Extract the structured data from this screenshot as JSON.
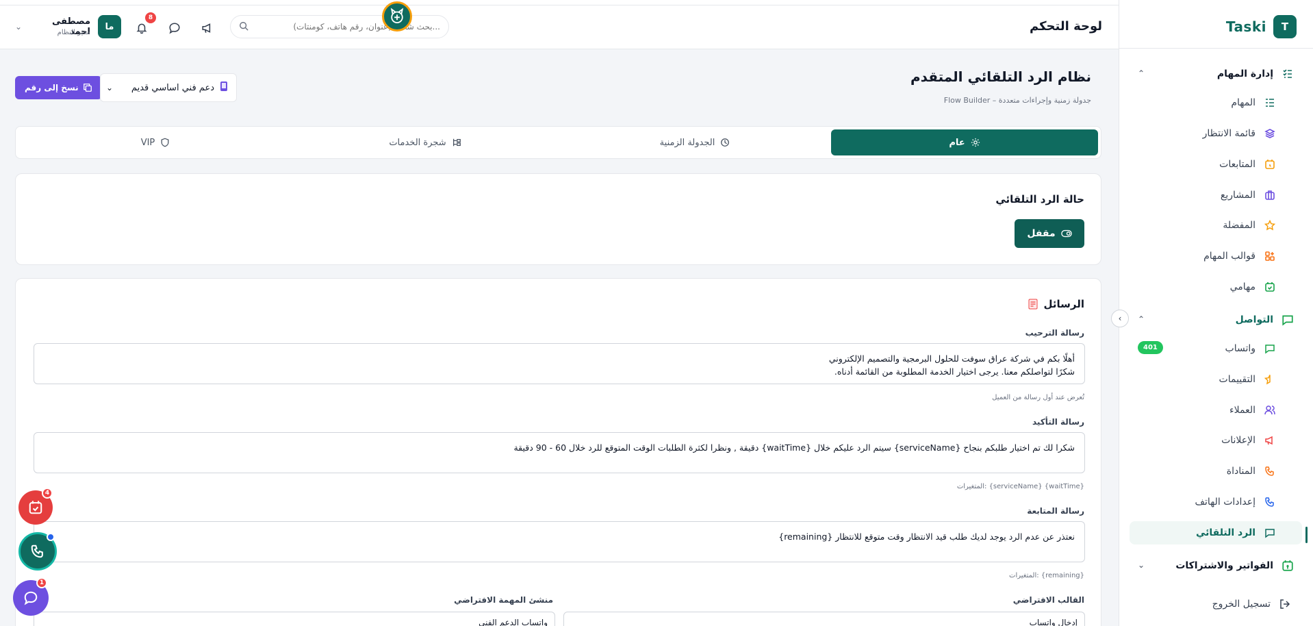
{
  "app": {
    "brand_letter": "T",
    "brand_name": "Taski"
  },
  "header": {
    "title": "لوحة التحكم",
    "search_placeholder": "بحث شامل (عنوان، رقم هاتف، كومنتات)...",
    "notification_count": "8",
    "user_initials": "ما",
    "user_name": "مصطفى احمد",
    "user_role": "مدير النظام"
  },
  "sidebar": {
    "task_group": "إدارة المهام",
    "task_items": [
      "المهام",
      "قائمة الانتظار",
      "المتابعات",
      "المشاريع",
      "المفضلة",
      "قوالب المهام",
      "مهامي"
    ],
    "comm_group": "التواصل",
    "comm_items": [
      "واتساب",
      "التقييمات",
      "العملاء",
      "الإعلانات",
      "المناداة",
      "إعدادات الهاتف",
      "الرد التلقائي"
    ],
    "whatsapp_badge": "401",
    "billing_group": "الفواتير والاشتراكات",
    "logout": "تسجيل الخروج"
  },
  "page": {
    "title": "نظام الرد التلقائي المتقدم",
    "subtitle": "Flow Builder – جدولة زمنية وإجراءات متعددة",
    "copy_button": "نسخ إلى رقم",
    "selected_number": "دعم فني اساسي قديم"
  },
  "tabs": [
    "عام",
    "الجدولة الزمنية",
    "شجرة الخدمات",
    "VIP"
  ],
  "status_card": {
    "title": "حالة الرد التلقائي",
    "button": "مقفل"
  },
  "messages_card": {
    "title": "الرسائل",
    "welcome_label": "رسالة الترحيب",
    "welcome_line1": "أهلًا بكم في شركة عراق سوفت للحلول البرمجية والتصميم الإلكتروني",
    "welcome_line2": "شكرًا لتواصلكم معنا. يرجى اختيار الخدمة المطلوبة من القائمة أدناه.",
    "welcome_help": "تُعرض عند أول رسالة من العميل",
    "confirm_label": "رسالة التأكيد",
    "confirm_text": "شكرا لك تم اختيار طلبكم بنجاح {serviceName} سيتم الرد عليكم خلال {waitTime} دقيقة ,  ونظرا لكثرة الطلبات الوقت المتوقع للرد خلال 60 - 90 دقيقة",
    "confirm_help": "المتغيرات: {serviceName} {waitTime}",
    "followup_label": "رسالة المتابعة",
    "followup_text": "نعتذر عن عدم الرد يوجد لديك طلب قيد الانتظار وقت متوقع للانتظار {remaining}",
    "followup_help": "المتغيرات: {remaining}",
    "template_label": "القالب الافتراضي",
    "template_value": "إدخال واتساب",
    "creator_label": "منشئ المهمة الافتراضي",
    "creator_value": "واتساب الدعم الفني"
  },
  "fabs": {
    "tasks_badge": "4",
    "chat_badge": "1"
  },
  "colors": {
    "primary": "#0f6b5f",
    "accent": "#6d4fe0",
    "danger": "#ef4444",
    "success": "#22c55e"
  }
}
